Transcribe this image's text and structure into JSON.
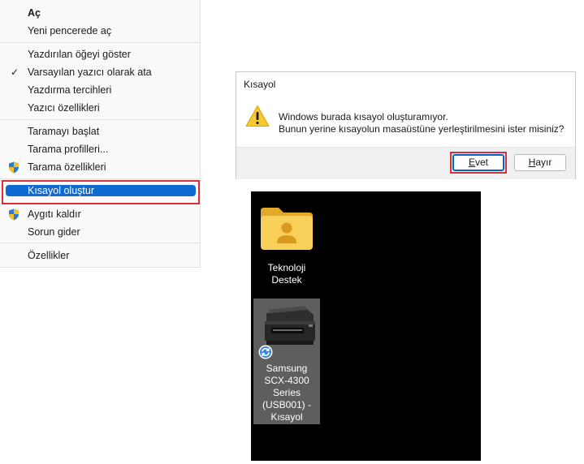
{
  "context_menu": {
    "items": [
      {
        "label": "Aç",
        "bold": true
      },
      {
        "label": "Yeni pencerede aç"
      },
      {
        "label": "Yazdırılan öğeyi göster"
      },
      {
        "label": "Varsayılan yazıcı olarak ata",
        "checked": true
      },
      {
        "label": "Yazdırma tercihleri"
      },
      {
        "label": "Yazıcı özellikleri"
      },
      {
        "label": "Taramayı başlat"
      },
      {
        "label": "Tarama profilleri..."
      },
      {
        "label": "Tarama özellikleri",
        "icon": "uac-shield-icon"
      },
      {
        "label": "Kısayol oluştur",
        "highlighted": true
      },
      {
        "label": "Aygıtı kaldır",
        "icon": "uac-shield-icon"
      },
      {
        "label": "Sorun gider"
      },
      {
        "label": "Özellikler"
      }
    ]
  },
  "dialog": {
    "title": "Kısayol",
    "icon": "warning-icon",
    "message_line1": "Windows burada kısayol oluşturamıyor.",
    "message_line2": "Bunun yerine kısayolun masaüstüne yerleştirilmesini ister misiniz?",
    "yes_label_accel": "E",
    "yes_label_rest": "vet",
    "no_label_accel": "H",
    "no_label_rest": "ayır"
  },
  "desktop": {
    "folder_icon": {
      "line1": "Teknoloji",
      "line2": "Destek",
      "icon": "user-folder-icon"
    },
    "printer_shortcut": {
      "line1": "Samsung",
      "line2": "SCX-4300",
      "line3": "Series",
      "line4": "(USB001) -",
      "line5": "Kısayol",
      "icon": "printer-icon",
      "overlay_icon": "shortcut-sync-icon"
    }
  },
  "colors": {
    "highlight": "#0e6ad1",
    "annotation_red": "#d6303b",
    "desktop_bg": "#000000",
    "selection_tile": "#5e5e5e"
  }
}
